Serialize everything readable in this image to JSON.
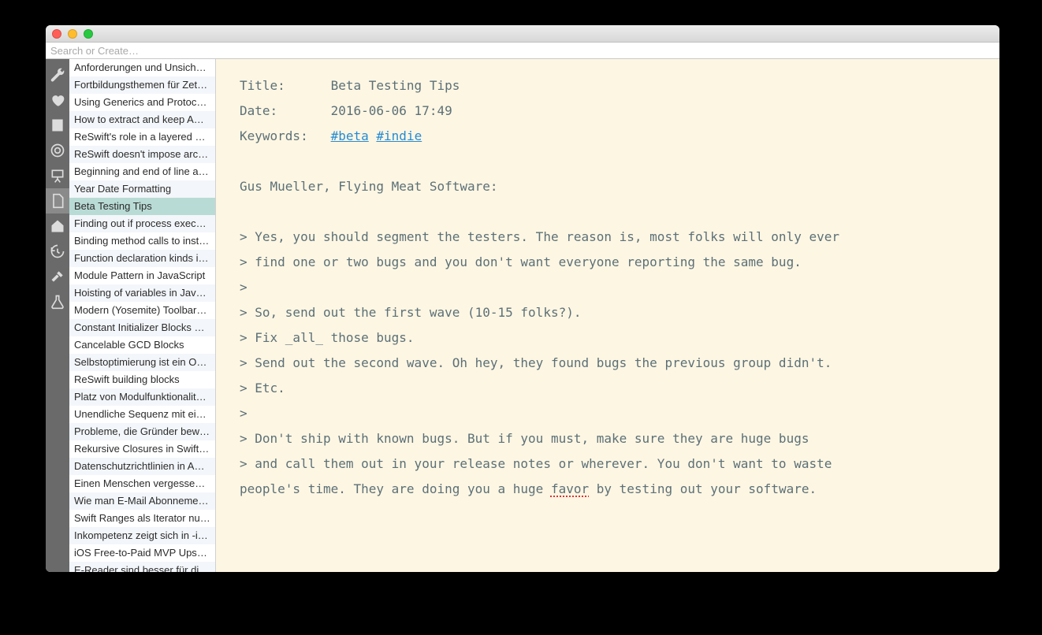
{
  "window": {
    "search_placeholder": "Search or Create…"
  },
  "rail": {
    "icons": [
      "wrench-icon",
      "heart-icon",
      "book-icon",
      "target-icon",
      "easel-icon",
      "file-icon",
      "home-icon",
      "history-icon",
      "hammer-icon",
      "flask-icon"
    ],
    "selected_index": 5
  },
  "notes": {
    "items": [
      "Anforderungen und Unsich…",
      "Fortbildungsthemen für Zet…",
      "Using Generics and Protoco…",
      "How to extract and keep AP…",
      "ReSwift's role in a layered a…",
      "ReSwift doesn't impose arc…",
      "Beginning and end of line a…",
      "Year Date Formatting",
      "Beta Testing Tips",
      "Finding out if process exec…",
      "Binding method calls to inst…",
      "Function declaration kinds i…",
      "Module Pattern in JavaScript",
      "Hoisting of variables in Java…",
      "Modern (Yosemite) Toolbar…",
      "Constant Initializer Blocks S…",
      "Cancelable GCD Blocks",
      "Selbstoptimierung ist ein O…",
      "ReSwift building blocks",
      "Platz von Modulfunktionalit…",
      "Unendliche Sequenz mit ein…",
      "Probleme, die Gründer bew…",
      "Rekursive Closures in Swift…",
      "Datenschutzrichtlinien in A…",
      "Einen Menschen vergessen…",
      "Wie man E-Mail Abonneme…",
      "Swift Ranges als Iterator nu…",
      "Inkompetenz zeigt sich in -i…",
      "iOS Free-to-Paid MVP Upse…",
      "E-Reader sind besser für di…"
    ],
    "selected_index": 8
  },
  "note": {
    "meta": {
      "title_label": "Title:",
      "title_value": "Beta Testing Tips",
      "date_label": "Date:",
      "date_value": "2016-06-06 17:49",
      "keywords_label": "Keywords:",
      "tags": [
        "#beta",
        "#indie"
      ]
    },
    "body_lines": [
      "",
      "Gus Mueller, Flying Meat Software:",
      "",
      "> Yes, you should segment the testers. The reason is, most folks will only ever",
      "> find one or two bugs and you don't want everyone reporting the same bug.",
      ">",
      "> So, send out the first wave (10-15 folks?).",
      "> Fix _all_ those bugs.",
      "> Send out the second wave. Oh hey, they found bugs the previous group didn't.",
      "> Etc.",
      ">",
      "> Don't ship with known bugs. But if you must, make sure they are huge bugs",
      "> and call them out in your release notes or wherever. You don't want to waste"
    ],
    "last_line_prefix": "people's time. They are doing you a huge ",
    "last_line_spell": "favor",
    "last_line_suffix": " by testing out your software."
  }
}
